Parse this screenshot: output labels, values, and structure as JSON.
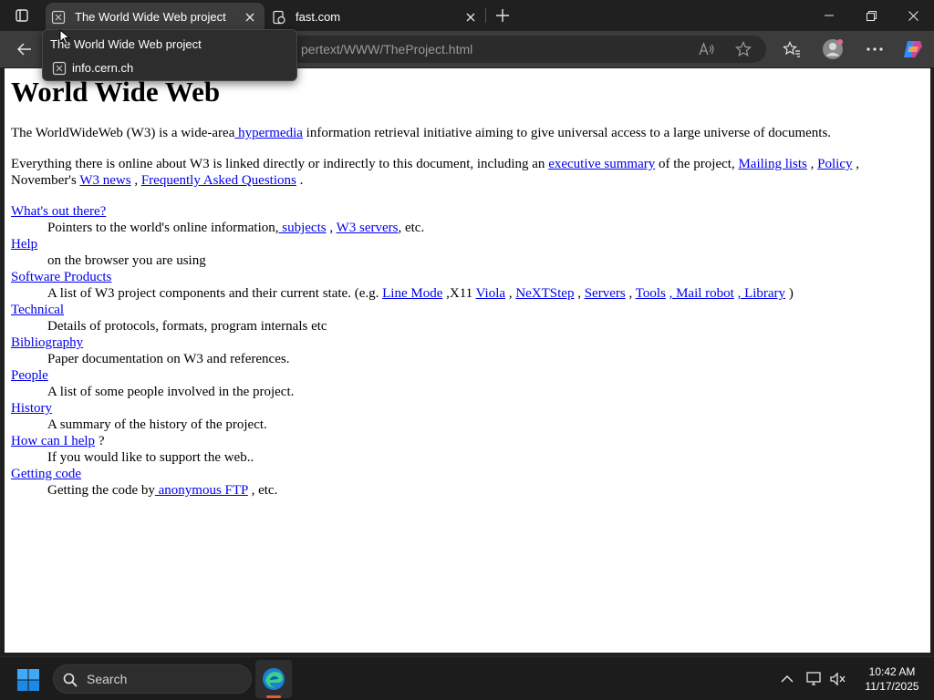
{
  "tabs": [
    {
      "title": "The World Wide Web project",
      "active": true
    },
    {
      "title": "fast.com",
      "active": false
    }
  ],
  "hovercard": {
    "title": "The World Wide Web project",
    "domain": "info.cern.ch"
  },
  "address_bar": {
    "url_visible": "pertext/WWW/TheProject.html"
  },
  "page": {
    "heading": "World Wide Web",
    "intro": {
      "text1": "The WorldWideWeb (W3) is a wide-area",
      "link_hypermedia": " hypermedia",
      "text2": " information retrieval initiative aiming to give universal access to a large universe of documents."
    },
    "everything": {
      "text1": "Everything there is online about W3 is linked directly or indirectly to this document, including an ",
      "link_exec": "executive summary",
      "text2": " of the project, ",
      "link_mailing": "Mailing lists",
      "text3": " , ",
      "link_policy": "Policy",
      "text4": " , November's ",
      "link_news": "W3 news",
      "text5": " , ",
      "link_faq": "Frequently Asked Questions",
      "text6": " ."
    },
    "items": {
      "whats_out": {
        "term": "What's out there?",
        "desc1": "Pointers to the world's online information,",
        "link_subjects": " subjects",
        "desc2": " , ",
        "link_servers": "W3 servers",
        "desc3": ", etc."
      },
      "help": {
        "term": "Help",
        "desc": "on the browser you are using"
      },
      "software": {
        "term": "Software Products",
        "desc1": "A list of W3 project components and their current state. (e.g. ",
        "link_linemode": "Line Mode",
        "desc2": " ,X11 ",
        "link_viola": "Viola",
        "desc3": " , ",
        "link_nextstep": "NeXTStep",
        "desc4": " , ",
        "link_servers": "Servers",
        "desc5": " , ",
        "link_tools": "Tools",
        "desc6": " ",
        "link_mailrobot": ", Mail robot",
        "desc7": " ",
        "link_library": ", Library",
        "desc8": " )"
      },
      "technical": {
        "term": "Technical",
        "desc": "Details of protocols, formats, program internals etc"
      },
      "bibliography": {
        "term": "Bibliography",
        "desc": "Paper documentation on W3 and references."
      },
      "people": {
        "term": "People",
        "desc": "A list of some people involved in the project."
      },
      "history": {
        "term": "History",
        "desc": "A summary of the history of the project."
      },
      "howhelp": {
        "term": "How can I help",
        "suffix": " ?",
        "desc": "If you would like to support the web.."
      },
      "code": {
        "term": "Getting code",
        "desc1": "Getting the code by",
        "link_ftp": " anonymous FTP",
        "desc2": " , etc."
      }
    }
  },
  "taskbar": {
    "search_label": "Search",
    "time": "10:42 AM",
    "date": "11/17/2025"
  },
  "colors": {
    "link": "#0000ee",
    "chrome_dark": "#202020",
    "tab_active": "#3c3c3c",
    "edge_indicator": "#e0612f"
  }
}
